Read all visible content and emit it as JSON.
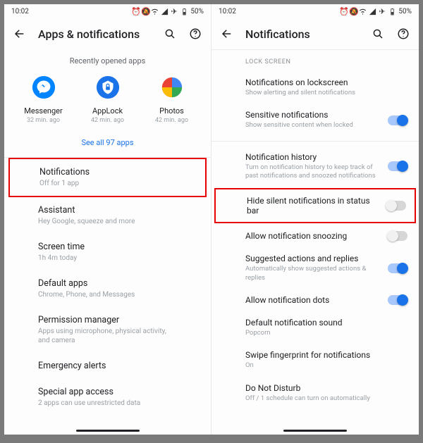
{
  "status": {
    "time": "10:02",
    "battery_pct": "50%"
  },
  "left": {
    "title": "Apps & notifications",
    "recent_caption": "Recently opened apps",
    "apps": [
      {
        "name": "Messenger",
        "sub": "32 min. ago"
      },
      {
        "name": "AppLock",
        "sub": "42 min. ago"
      },
      {
        "name": "Photos",
        "sub": "42 min. ago"
      }
    ],
    "see_all": "See all 97 apps",
    "rows": [
      {
        "label": "Notifications",
        "sub": "Off for 1 app",
        "highlight": true
      },
      {
        "label": "Assistant",
        "sub": "Hey Google, squeeze and more"
      },
      {
        "label": "Screen time",
        "sub": "1h 4m today"
      },
      {
        "label": "Default apps",
        "sub": "Chrome, Phone, and Messages"
      },
      {
        "label": "Permission manager",
        "sub": "Apps using microphone, physical activity, and camera"
      },
      {
        "label": "Emergency alerts",
        "sub": ""
      },
      {
        "label": "Special app access",
        "sub": "2 apps can use unrestricted data"
      }
    ]
  },
  "right": {
    "title": "Notifications",
    "section": "LOCK SCREEN",
    "items": [
      {
        "label": "Notifications on lockscreen",
        "sub": "Show alerting and silent notifications",
        "toggle": null
      },
      {
        "label": "Sensitive notifications",
        "sub": "Show sensitive content when locked",
        "toggle": true
      },
      {
        "divider": true
      },
      {
        "label": "Notification history",
        "sub": "Turn on notification history to keep track of past notifications and snoozed notifications",
        "toggle": true
      },
      {
        "label": "Hide silent notifications in status bar",
        "sub": "",
        "toggle": false,
        "highlight": true
      },
      {
        "label": "Allow notification snoozing",
        "sub": "",
        "toggle": false
      },
      {
        "label": "Suggested actions and replies",
        "sub": "Automatically show suggested actions & replies",
        "toggle": true
      },
      {
        "label": "Allow notification dots",
        "sub": "",
        "toggle": true
      },
      {
        "label": "Default notification sound",
        "sub": "Popcorn",
        "toggle": null
      },
      {
        "label": "Swipe fingerprint for notifications",
        "sub": "On",
        "toggle": null
      },
      {
        "label": "Do Not Disturb",
        "sub": "Off / 1 schedule can turn on automatically",
        "toggle": null
      }
    ]
  }
}
